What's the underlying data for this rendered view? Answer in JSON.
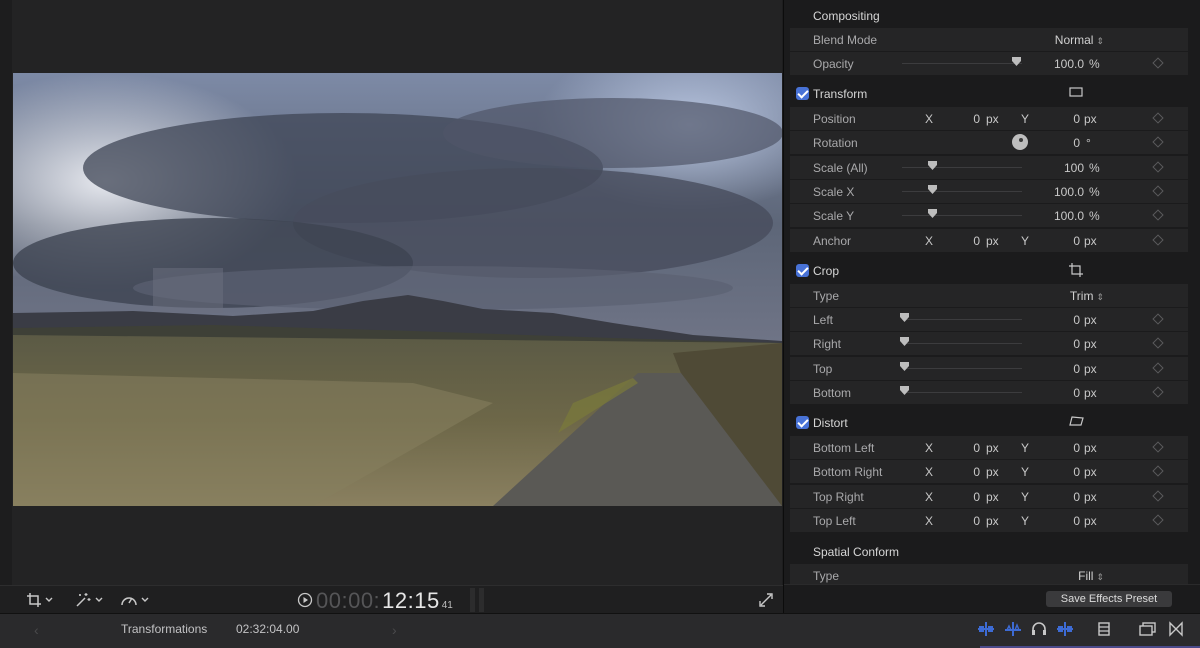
{
  "viewer": {
    "timecode_dim": "00:00:",
    "timecode_main": "12:15",
    "timecode_frames": "41"
  },
  "inspector": {
    "compositing": {
      "title": "Compositing",
      "blend_mode_label": "Blend Mode",
      "blend_mode_value": "Normal",
      "opacity_label": "Opacity",
      "opacity_value": "100.0",
      "opacity_unit": "%",
      "opacity_level": 1.0
    },
    "transform": {
      "title": "Transform",
      "enabled": true,
      "position_label": "Position",
      "x_label": "X",
      "y_label": "Y",
      "position_x": "0",
      "position_y": "0",
      "unit_px": "px",
      "rotation_label": "Rotation",
      "rotation_value": "0",
      "rotation_unit": "°",
      "scale_all_label": "Scale (All)",
      "scale_all_value": "100",
      "scale_x_label": "Scale X",
      "scale_x_value": "100.0",
      "scale_y_label": "Scale Y",
      "scale_y_value": "100.0",
      "unit_percent": "%",
      "anchor_label": "Anchor",
      "anchor_x": "0",
      "anchor_y": "0"
    },
    "crop": {
      "title": "Crop",
      "enabled": true,
      "type_label": "Type",
      "type_value": "Trim",
      "left_label": "Left",
      "left_value": "0",
      "right_label": "Right",
      "right_value": "0",
      "top_label": "Top",
      "top_value": "0",
      "bottom_label": "Bottom",
      "bottom_value": "0"
    },
    "distort": {
      "title": "Distort",
      "enabled": true,
      "bottom_left_label": "Bottom Left",
      "bottom_left_x": "0",
      "bottom_left_y": "0",
      "bottom_right_label": "Bottom Right",
      "bottom_right_x": "0",
      "bottom_right_y": "0",
      "top_right_label": "Top Right",
      "top_right_x": "0",
      "top_right_y": "0",
      "top_left_label": "Top Left",
      "top_left_x": "0",
      "top_left_y": "0"
    },
    "spatial_conform": {
      "title": "Spatial Conform",
      "type_label": "Type",
      "type_value": "Fill"
    },
    "save_preset_label": "Save Effects Preset"
  },
  "bottom_bar": {
    "title": "Transformations",
    "duration": "02:32:04.00"
  },
  "colors": {
    "accent_blue": "#4872d6",
    "panel_bg": "#1b1b1c",
    "row_bg": "#252526",
    "audio_icon_blue": "#3d6bd4"
  }
}
